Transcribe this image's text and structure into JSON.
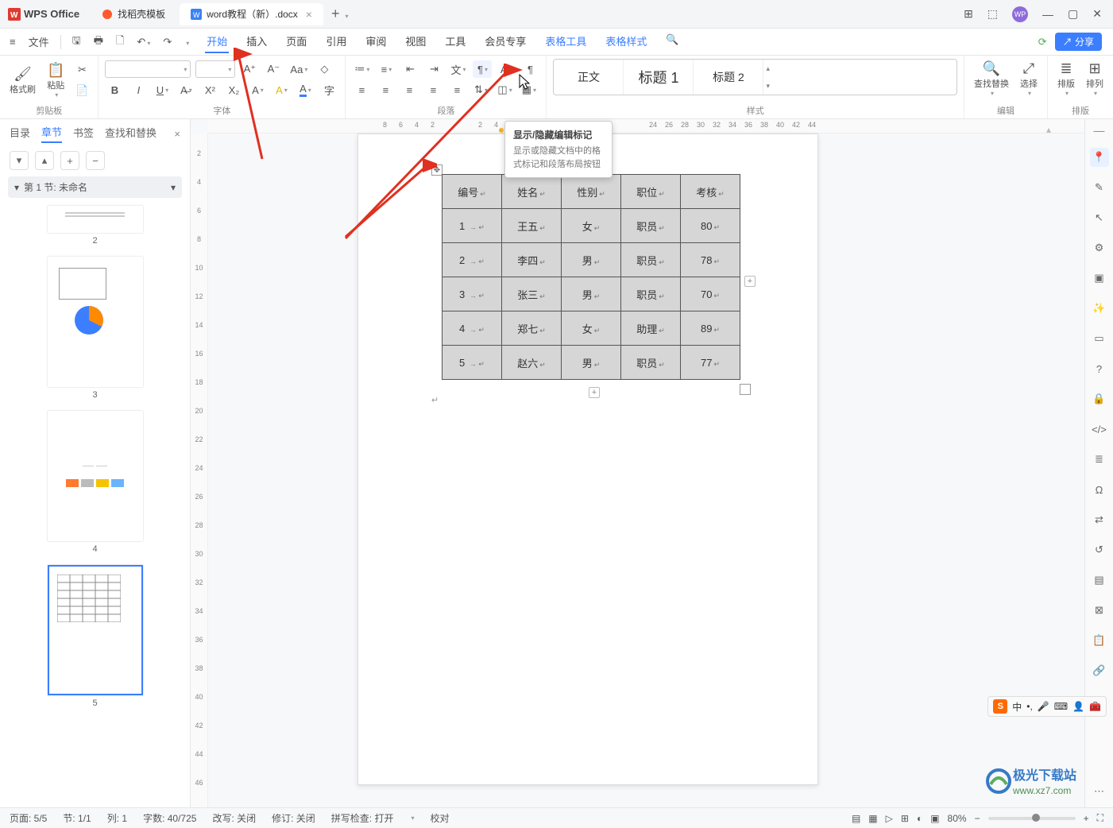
{
  "app": {
    "name": "WPS Office"
  },
  "tabs": [
    {
      "label": "找稻壳模板",
      "icon_color": "#ff5a2b"
    },
    {
      "label": "word教程（新）.docx",
      "icon_color": "#3b82f6",
      "active": true
    }
  ],
  "quick": {
    "file_label": "文件"
  },
  "menu": {
    "items": [
      "开始",
      "插入",
      "页面",
      "引用",
      "审阅",
      "视图",
      "工具",
      "会员专享"
    ],
    "extra": [
      "表格工具",
      "表格样式"
    ],
    "active": "开始",
    "share": "分享"
  },
  "ribbon": {
    "clipboard": {
      "format_painter": "格式刷",
      "paste": "粘贴",
      "group_label": "剪贴板"
    },
    "font": {
      "group_label": "字体"
    },
    "paragraph": {
      "group_label": "段落"
    },
    "styles": {
      "items": [
        "正文",
        "标题 1",
        "标题 2"
      ],
      "group_label": "样式"
    },
    "edit": {
      "find_replace": "查找替换",
      "select": "选择",
      "group_label": "编辑"
    },
    "arrange": {
      "sort": "排版",
      "align": "排列",
      "group_label": "排版"
    }
  },
  "tooltip": {
    "title": "显示/隐藏编辑标记",
    "body": "显示或隐藏文档中的格式标记和段落布局按钮"
  },
  "nav": {
    "tabs": [
      "目录",
      "章节",
      "书签",
      "查找和替换"
    ],
    "active": "章节",
    "section": "第 1 节: 未命名",
    "thumbs": [
      "2",
      "3",
      "4",
      "5"
    ],
    "selected": "5"
  },
  "chart_data": {
    "type": "table",
    "headers": [
      "编号",
      "姓名",
      "性别",
      "职位",
      "考核"
    ],
    "rows": [
      [
        "1",
        "王五",
        "女",
        "职员",
        "80"
      ],
      [
        "2",
        "李四",
        "男",
        "职员",
        "78"
      ],
      [
        "3",
        "张三",
        "男",
        "职员",
        "70"
      ],
      [
        "4",
        "郑七",
        "女",
        "助理",
        "89"
      ],
      [
        "5",
        "赵六",
        "男",
        "职员",
        "77"
      ]
    ]
  },
  "ruler_h": [
    8,
    6,
    4,
    2,
    2,
    4,
    6,
    24,
    26,
    28,
    30,
    32,
    34,
    36,
    38,
    40,
    42,
    44
  ],
  "ruler_v": [
    2,
    4,
    6,
    8,
    10,
    12,
    14,
    16,
    18,
    20,
    22,
    24,
    26,
    28,
    30,
    32,
    34,
    36,
    38,
    40,
    42,
    44,
    46
  ],
  "status": {
    "page": "页面: 5/5",
    "section": "节: 1/1",
    "col": "列: 1",
    "words": "字数: 40/725",
    "track": "改写: 关闭",
    "revision": "修订: 关闭",
    "spell": "拼写检查: 打开",
    "review": "校对",
    "zoom": "80%"
  },
  "ime": {
    "ch": "中"
  },
  "watermark": {
    "line1": "极光下载站",
    "line2": "www.xz7.com"
  }
}
